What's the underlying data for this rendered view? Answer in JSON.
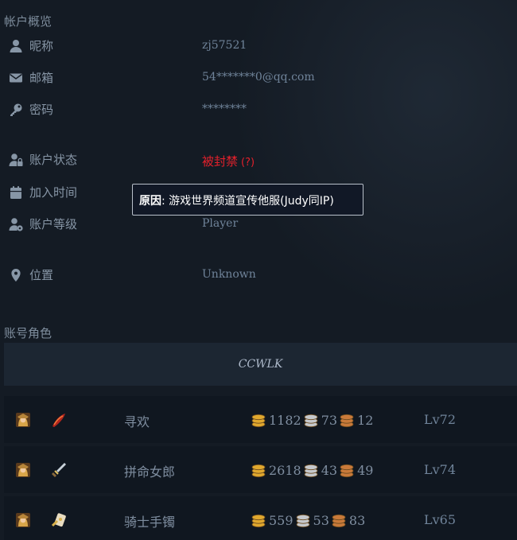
{
  "overview": {
    "title": "帐户概览",
    "nickname": {
      "label": "昵称",
      "value": "zj57521",
      "icon": "user-icon"
    },
    "email": {
      "label": "邮箱",
      "value": "54*******0@qq.com",
      "icon": "envelope-icon"
    },
    "password": {
      "label": "密码",
      "value": "********",
      "icon": "key-icon"
    },
    "status": {
      "label": "账户状态",
      "value": "被封禁",
      "help": "(?)",
      "icon": "user-lock-icon",
      "color": "#e3202b"
    },
    "joined": {
      "label": "加入时间",
      "icon": "calendar-icon"
    },
    "level": {
      "label": "账户等级",
      "value": "Player",
      "icon": "user-cog-icon"
    },
    "location": {
      "label": "位置",
      "value": "Unknown",
      "icon": "map-marker-icon"
    }
  },
  "tooltip": {
    "prefix": "原因",
    "text": ": 游戏世界频道宣传他服(Judy同IP)"
  },
  "characters": {
    "title": "账号角色",
    "realm": "CCWLK",
    "list": [
      {
        "name": "寻欢",
        "gold": "1182",
        "silver": "73",
        "copper": "12",
        "level": "Lv72",
        "race_icon": "human-female-race-icon",
        "class_icon": "rogue-class-icon"
      },
      {
        "name": "拼命女郎",
        "gold": "2618",
        "silver": "43",
        "copper": "49",
        "level": "Lv74",
        "race_icon": "human-female-race-icon",
        "class_icon": "warrior-class-icon"
      },
      {
        "name": "骑士手镯",
        "gold": "559",
        "silver": "53",
        "copper": "83",
        "level": "Lv65",
        "race_icon": "human-female-race-icon",
        "class_icon": "paladin-class-icon"
      }
    ]
  },
  "colors": {
    "background": "#141b24",
    "banned": "#e3202b",
    "gold": "#e0a82e",
    "silver": "#c5c8cc",
    "copper": "#c97a3a"
  }
}
